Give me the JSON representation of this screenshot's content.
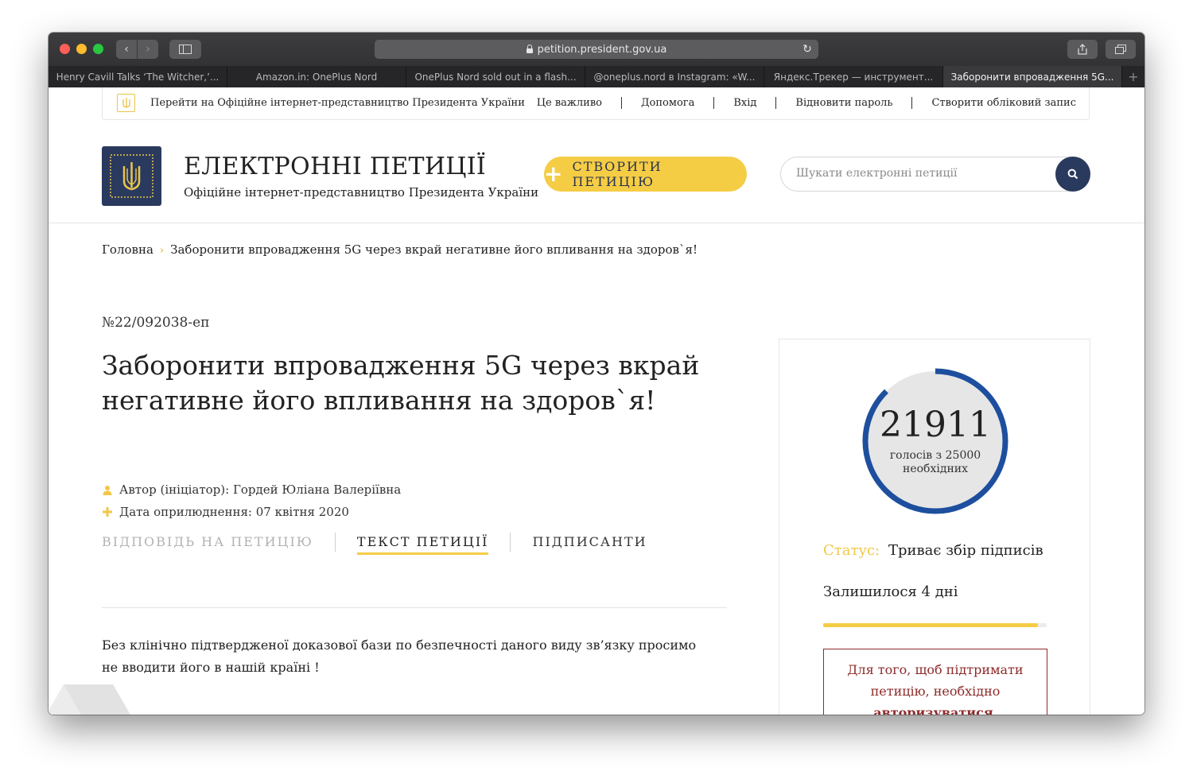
{
  "browser": {
    "url": "petition.president.gov.ua",
    "tabs": [
      {
        "label": "Henry Cavill Talks ‘The Witcher,’..."
      },
      {
        "label": "Amazon.in: OnePlus Nord"
      },
      {
        "label": "OnePlus Nord sold out in a flash..."
      },
      {
        "label": "@oneplus.nord в Instagram: «W..."
      },
      {
        "label": "Яндекс.Трекер — инструмент..."
      },
      {
        "label": "Заборонити впровадження 5G..."
      }
    ],
    "new_tab_label": "+"
  },
  "topstrip": {
    "official_link": "Перейти на Офіційне інтернет-представництво Президента України",
    "links": [
      "Це важливо",
      "Допомога",
      "Вхід",
      "Відновити пароль",
      "Створити обліковий запис"
    ]
  },
  "header": {
    "title": "ЕЛЕКТРОННІ ПЕТИЦІЇ",
    "subtitle": "Офіційне інтернет-представництво Президента України",
    "create_button": "СТВОРИТИ ПЕТИЦІЮ",
    "search_placeholder": "Шукати електронні петиції"
  },
  "breadcrumb": {
    "home": "Головна",
    "separator": "›",
    "current": "Заборонити впровадження 5G через вкрай негативне його впливання на здоров`я!"
  },
  "petition": {
    "number": "№22/092038-еп",
    "title": "Заборонити впровадження 5G через вкрай негативне його впливання на здоров`я!",
    "author": "Автор (ініціатор): Гордей Юліана Валеріївна",
    "date": "Дата оприлюднення: 07 квітня 2020",
    "tabs": [
      {
        "label": "ВІДПОВІДЬ НА ПЕТИЦІЮ"
      },
      {
        "label": "ТЕКСТ ПЕТИЦІЇ"
      },
      {
        "label": "ПІДПИСАНТИ"
      }
    ],
    "text": "Без клінічно підтвердженої доказової бази по безпечності даного виду зв’язку просимо не вводити його в нашій країні !"
  },
  "votes": {
    "count": "21911",
    "subtitle_line1": "голосів з 25000",
    "subtitle_line2": "необхідних",
    "collected": 21911,
    "required": 25000
  },
  "status": {
    "label": "Статус:",
    "value": "Триває збір підписів",
    "remaining": "Залишилося 4 дні",
    "time_progress": 0.96
  },
  "auth": {
    "line1": "Для того, щоб підтримати",
    "line2": "петицію, необхідно",
    "link": "авторизуватися",
    "end": "."
  },
  "colors": {
    "accent_yellow": "#f5cd45",
    "navy": "#2a3a5e",
    "gauge_blue": "#1d4f9e",
    "auth_red": "#8e2b2b"
  }
}
